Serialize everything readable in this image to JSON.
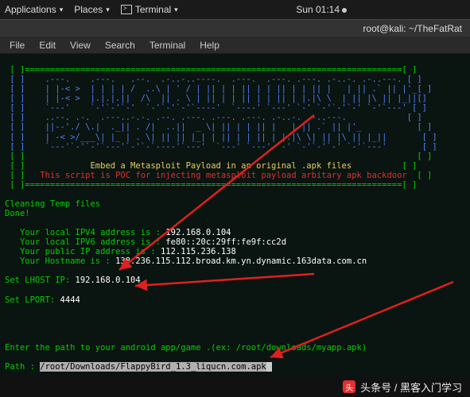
{
  "topbar": {
    "applications": "Applications",
    "places": "Places",
    "terminal": "Terminal",
    "datetime": "Sun 01:14"
  },
  "window": {
    "title": "root@kali: ~/TheFatRat"
  },
  "menu": {
    "file": "File",
    "edit": "Edit",
    "view": "View",
    "search": "Search",
    "terminal": "Terminal",
    "help": "Help"
  },
  "terminal": {
    "banner_msg1": "Embed a Metasploit Payload in an original .apk files",
    "banner_msg2": "This script is POC for injecting metasploit payload arbitary apk backdoor",
    "cleaning": "Cleaning Temp files",
    "done": "Done!",
    "ipv4_label": "   Your local IPV4 address is : ",
    "ipv4_value": "192.168.0.104",
    "ipv6_label": "   Your local IPV6 address is : ",
    "ipv6_value": "fe80::20c:29ff:fe9f:cc2d",
    "pubip_label": "   Your public IP address is : ",
    "pubip_value": "112.115.236.138",
    "host_label": "   Your Hostname is : ",
    "host_value": "138.236.115.112.broad.km.yn.dynamic.163data.com.cn",
    "lhost_label": "Set LHOST IP: ",
    "lhost_value": "192.168.0.104",
    "lport_label": "Set LPORT: ",
    "lport_value": "4444",
    "path_prompt": "Enter the path to your android app/game .(ex: /root/downloads/myapp.apk)",
    "path_label": "Path : ",
    "path_value": "/root/Downloads/FlappyBird_1.3_liqucn.com.apk"
  },
  "footer": {
    "text": "头条号 / 黑客入门学习"
  }
}
